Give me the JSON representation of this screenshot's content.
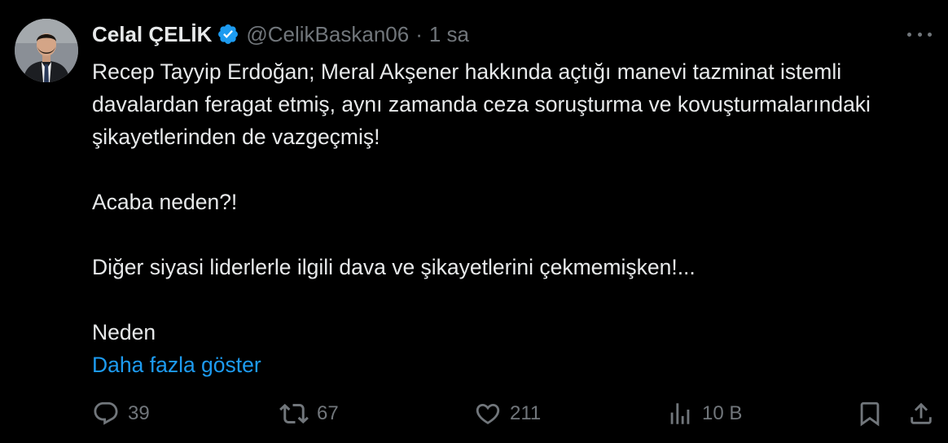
{
  "author": {
    "display_name": "Celal ÇELİK",
    "handle": "@CelikBaskan06",
    "separator": "·",
    "time": "1 sa",
    "verified_icon": "verified-badge-icon",
    "verified_color": "#1d9bf0"
  },
  "tweet": {
    "paragraphs": [
      "Recep Tayyip Erdoğan; Meral Akşener hakkında açtığı manevi tazminat istemli davalardan feragat etmiş, aynı zamanda ceza soruşturma ve kovuşturmalarındaki şikayetlerinden de vazgeçmiş!",
      "Acaba neden?!",
      "Diğer siyasi liderlerle ilgili dava ve şikayetlerini çekmemişken!...",
      "Neden"
    ],
    "show_more": "Daha fazla göster"
  },
  "actions": {
    "replies": "39",
    "reposts": "67",
    "likes": "211",
    "views": "10 B"
  },
  "colors": {
    "background": "#000000",
    "text": "#e7e9ea",
    "secondary": "#71767b",
    "link": "#1d9bf0"
  }
}
